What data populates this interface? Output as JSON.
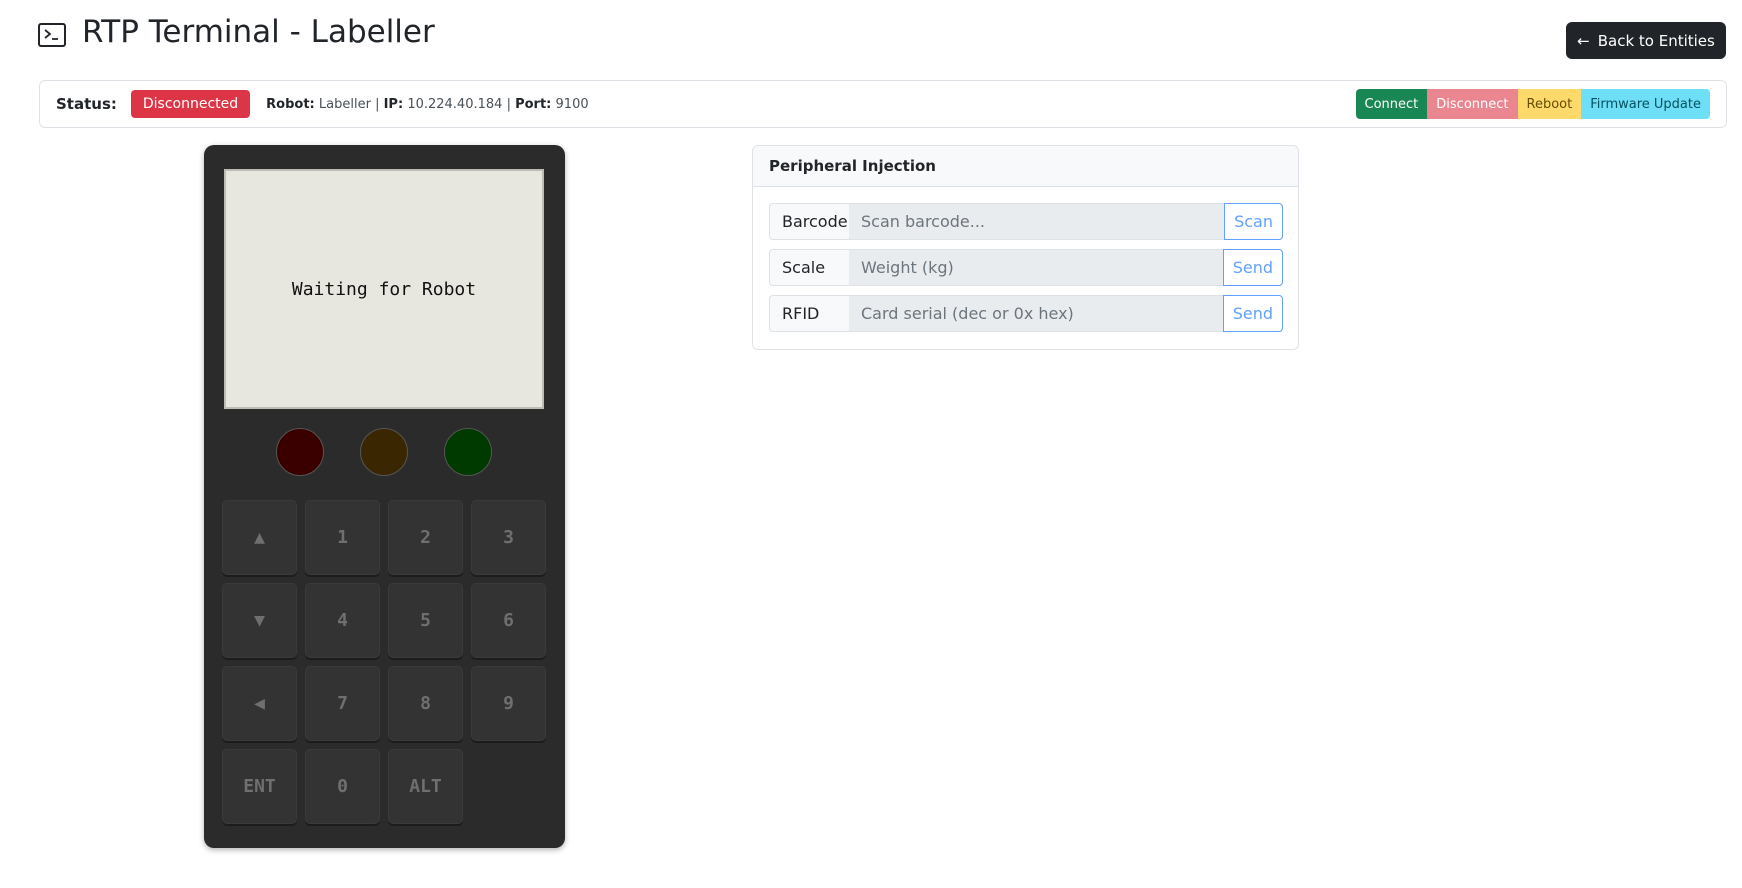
{
  "header": {
    "title": "RTP Terminal - Labeller",
    "back_label": "Back to Entities"
  },
  "status": {
    "label": "Status:",
    "badge": "Disconnected",
    "robot_key": "Robot:",
    "robot_value": "Labeller",
    "sep1": "|",
    "ip_key": "IP:",
    "ip_value": "10.224.40.184",
    "sep2": "|",
    "port_key": "Port:",
    "port_value": "9100",
    "actions": {
      "connect": "Connect",
      "disconnect": "Disconnect",
      "reboot": "Reboot",
      "firmware": "Firmware Update"
    }
  },
  "terminal": {
    "screen_text": "Waiting for Robot",
    "keys": {
      "up": "▲",
      "k1": "1",
      "k2": "2",
      "k3": "3",
      "down": "▼",
      "k4": "4",
      "k5": "5",
      "k6": "6",
      "left": "◀",
      "k7": "7",
      "k8": "8",
      "k9": "9",
      "ent": "ENT",
      "k0": "0",
      "alt": "ALT"
    },
    "leds": {
      "red": "#3a0000",
      "amber": "#3a2600",
      "green": "#003a00"
    }
  },
  "peripheral": {
    "title": "Peripheral Injection",
    "barcode": {
      "label": "Barcode",
      "placeholder": "Scan barcode...",
      "button": "Scan"
    },
    "scale": {
      "label": "Scale",
      "placeholder": "Weight (kg)",
      "button": "Send"
    },
    "rfid": {
      "label": "RFID",
      "placeholder": "Card serial (dec or 0x hex)",
      "button": "Send"
    }
  }
}
